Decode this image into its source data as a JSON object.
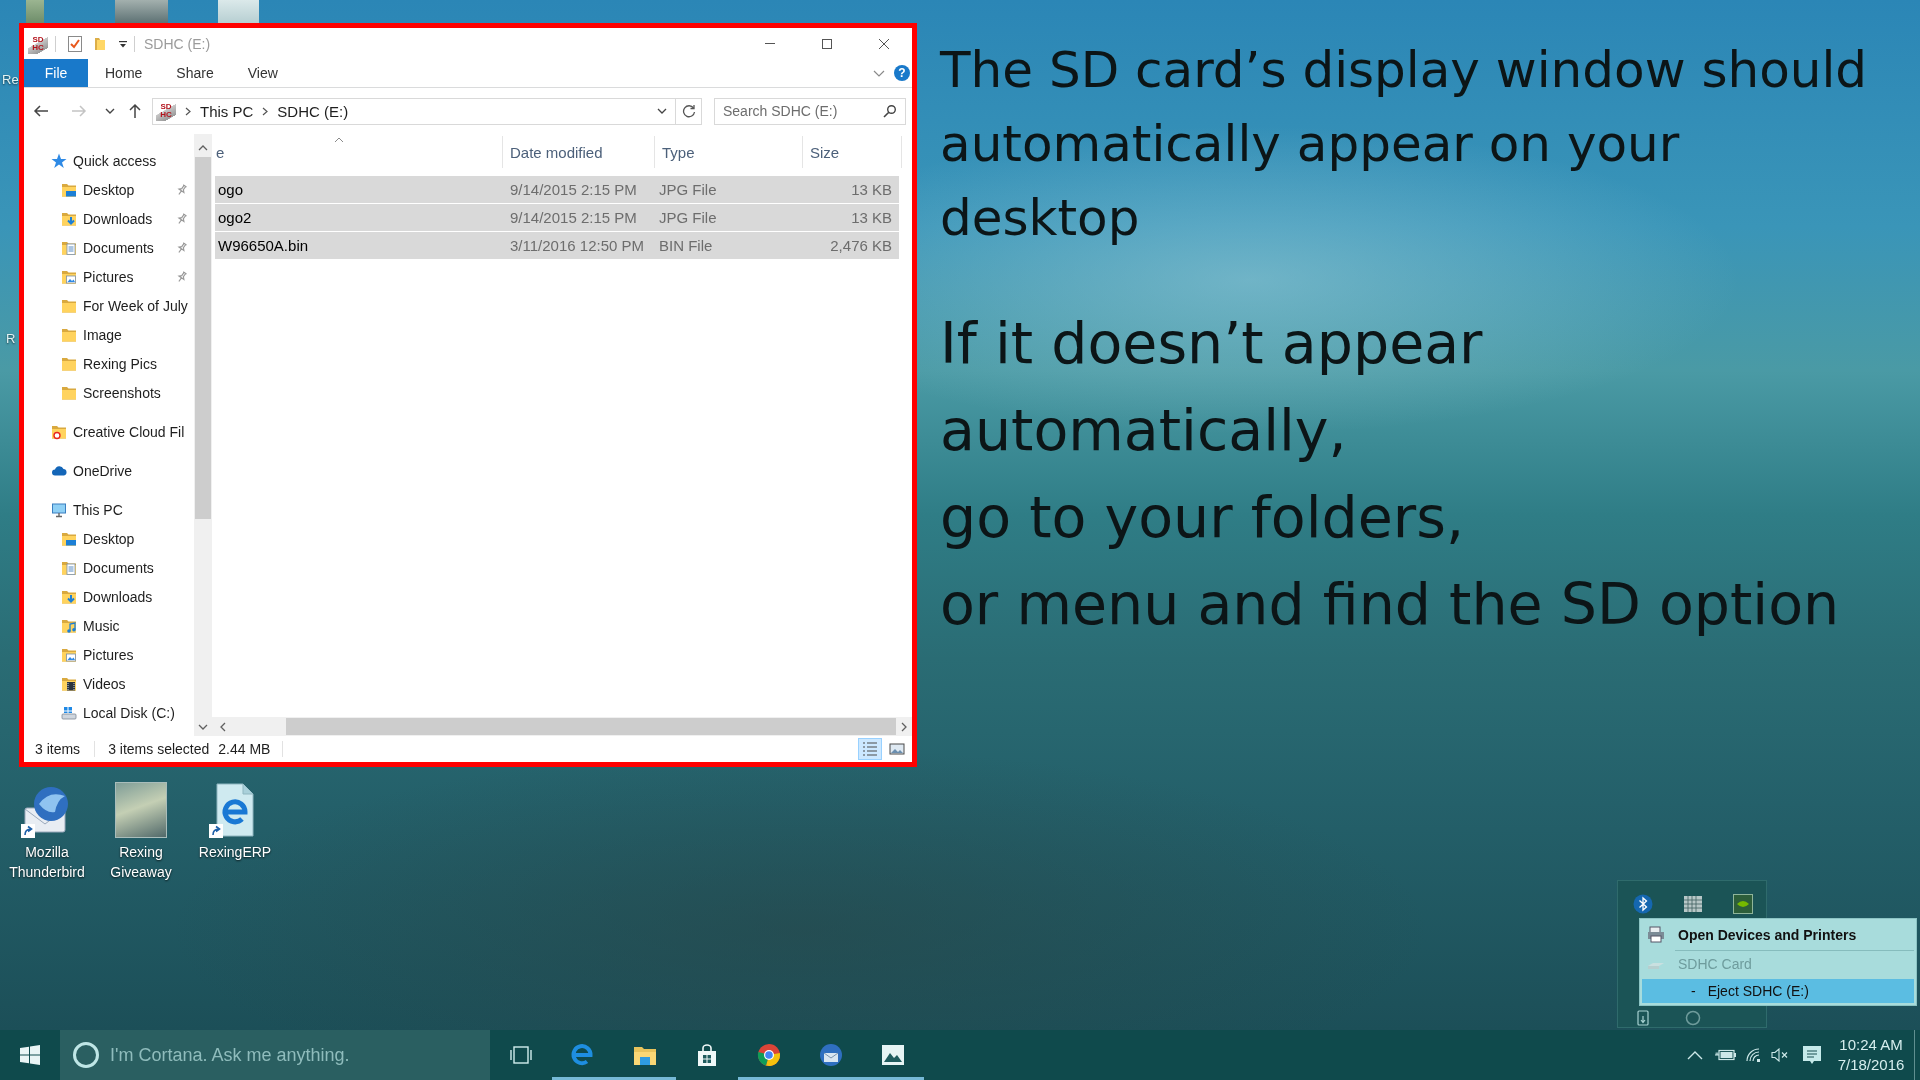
{
  "desktop": {
    "partial_labels": [
      "Re",
      "R"
    ],
    "icons": [
      {
        "label": "Mozilla Thunderbird",
        "shortcut": true
      },
      {
        "label": "Rexing Giveaway",
        "shortcut": false
      },
      {
        "label": "RexingERP",
        "shortcut": true
      }
    ]
  },
  "explorer": {
    "title_logo": [
      "SD",
      "HC"
    ],
    "title": "SDHC (E:)",
    "ribbon": {
      "tabs": [
        {
          "label": "File",
          "kind": "menu"
        },
        {
          "label": "Home",
          "kind": "tab"
        },
        {
          "label": "Share",
          "kind": "tab"
        },
        {
          "label": "View",
          "kind": "tab"
        }
      ],
      "help": "?"
    },
    "nav_buttons": [
      {
        "disabled": false
      },
      {
        "disabled": true
      },
      {
        "disabled": false
      },
      {
        "disabled": false
      }
    ],
    "address": {
      "logo": [
        "SD",
        "HC"
      ],
      "path": [
        "This PC",
        "SDHC (E:)"
      ]
    },
    "search": {
      "placeholder": "Search SDHC (E:)"
    },
    "nav_pane": [
      {
        "label": "Quick access",
        "children": [
          {
            "label": "Desktop",
            "pinned": true
          },
          {
            "label": "Downloads",
            "pinned": true
          },
          {
            "label": "Documents",
            "pinned": true
          },
          {
            "label": "Pictures",
            "pinned": true
          },
          {
            "label": "For Week of July",
            "pinned": false
          },
          {
            "label": "Image",
            "pinned": false
          },
          {
            "label": "Rexing Pics",
            "pinned": false
          },
          {
            "label": "Screenshots",
            "pinned": false
          }
        ]
      },
      {
        "label": "Creative Cloud Fil"
      },
      {
        "label": "OneDrive"
      },
      {
        "label": "This PC",
        "children": [
          {
            "label": "Desktop",
            "pinned": false
          },
          {
            "label": "Documents",
            "pinned": false
          },
          {
            "label": "Downloads",
            "pinned": false
          },
          {
            "label": "Music",
            "pinned": false
          },
          {
            "label": "Pictures",
            "pinned": false
          },
          {
            "label": "Videos",
            "pinned": false
          },
          {
            "label": "Local Disk (C:)",
            "pinned": false
          }
        ]
      }
    ],
    "columns": [
      {
        "label": "e",
        "sorted": true
      },
      {
        "label": "Date modified",
        "sorted": false
      },
      {
        "label": "Type",
        "sorted": false
      },
      {
        "label": "Size",
        "sorted": false
      }
    ],
    "files": [
      {
        "name": "ogo",
        "date": "9/14/2015 2:15 PM",
        "type": "JPG File",
        "size": "13 KB",
        "selected": true
      },
      {
        "name": "ogo2",
        "date": "9/14/2015 2:15 PM",
        "type": "JPG File",
        "size": "13 KB",
        "selected": true
      },
      {
        "name": "W96650A.bin",
        "date": "3/11/2016 12:50 PM",
        "type": "BIN File",
        "size": "2,476 KB",
        "selected": true
      }
    ],
    "status": {
      "items": "3 items",
      "selected": "3 items selected",
      "size": "2.44 MB"
    },
    "views": [
      {
        "selected": true
      },
      {
        "selected": false
      }
    ]
  },
  "annotation": {
    "intro": "The SD card’s display window should automatically appear on your desktop",
    "steps": [
      "If it doesn’t appear automatically,",
      "go to your folders,",
      "or menu and find the SD option"
    ]
  },
  "tray_popup": {
    "menu": [
      {
        "label": "Open Devices and Printers",
        "default": true,
        "disabled": false,
        "selected": false
      },
      {
        "label": "SDHC Card",
        "default": false,
        "disabled": true,
        "selected": false
      },
      {
        "marker": "-",
        "label": "Eject SDHC (E:)",
        "default": false,
        "disabled": false,
        "selected": true
      }
    ]
  },
  "taskbar": {
    "search": {
      "placeholder": "I'm Cortana. Ask me anything."
    },
    "apps": [
      {
        "running": true
      },
      {
        "running": true
      },
      {
        "running": false
      },
      {
        "running": true
      },
      {
        "running": true
      },
      {
        "running": true
      }
    ],
    "muted": true,
    "clock": {
      "time": "10:24 AM",
      "date": "7/18/2016"
    }
  }
}
